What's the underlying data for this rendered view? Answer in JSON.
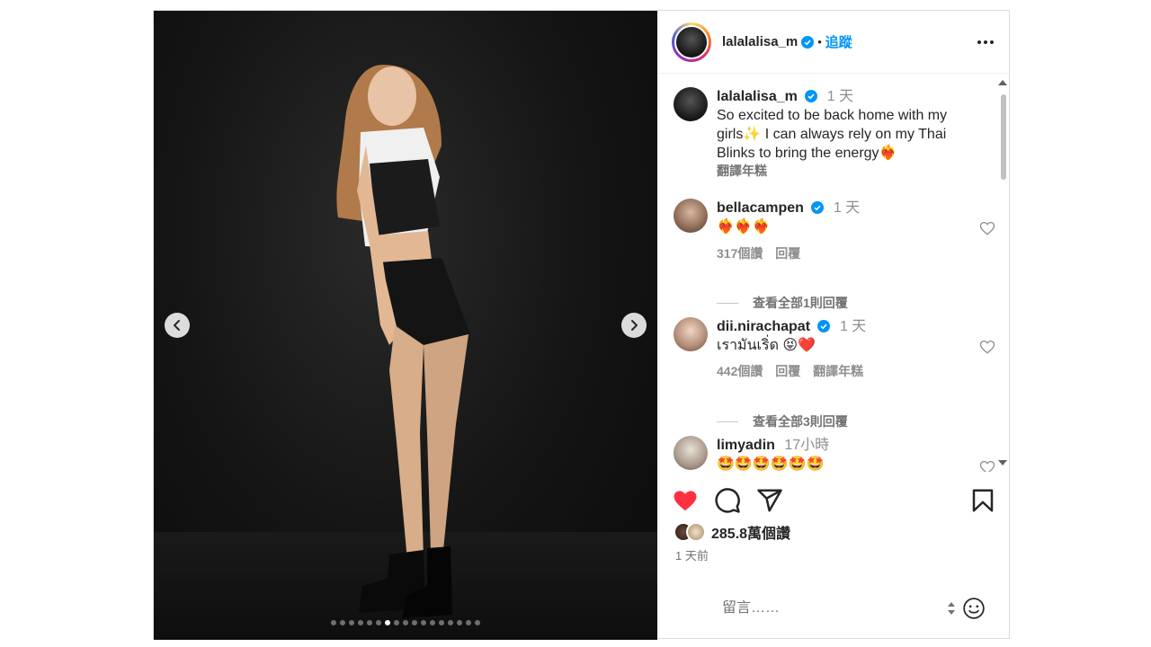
{
  "post": {
    "author": "lalalalisa_m",
    "follow_label": "追蹤",
    "separator": "•",
    "more_icon": "more-horizontal-icon"
  },
  "carousel": {
    "total_slides": 17,
    "active_slide": 7,
    "prev_icon": "chevron-left-icon",
    "next_icon": "chevron-right-icon"
  },
  "caption": {
    "username": "lalalalisa_m",
    "time": "1 天",
    "text": "So excited to be back home with my girls✨ I can always rely on my Thai Blinks to bring the energy❤️‍🔥",
    "translate": "翻譯年糕"
  },
  "comments": [
    {
      "username": "bellacampen",
      "time": "1 天",
      "text": "❤️‍🔥❤️‍🔥❤️‍🔥",
      "likes": "317個讚",
      "reply": "回覆",
      "view_replies": "查看全部1則回覆"
    },
    {
      "username": "dii.nirachapat",
      "time": "1 天",
      "text": "เรามันเริ่ด 😝❤️",
      "likes": "442個讚",
      "reply": "回覆",
      "translate": "翻譯年糕",
      "view_replies": "查看全部3則回覆"
    },
    {
      "username": "limyadin",
      "time": "17小時",
      "text": "🤩🤩🤩🤩🤩🤩"
    }
  ],
  "actions": {
    "like_icon": "heart-filled-icon",
    "comment_icon": "comment-icon",
    "share_icon": "send-icon",
    "save_icon": "bookmark-icon",
    "like_color": "#ff3040"
  },
  "likes_count": "285.8萬個讚",
  "posted_ago": "1 天前",
  "comment_input": {
    "placeholder": "留言……"
  },
  "colors": {
    "link": "#0095f6",
    "secondary_text": "#737373",
    "verified": "#0095f6"
  }
}
